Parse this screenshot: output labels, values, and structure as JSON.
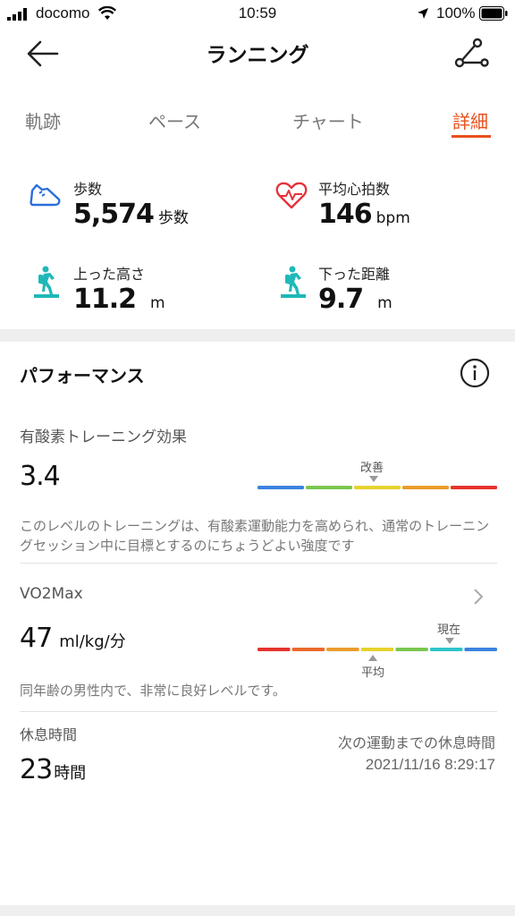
{
  "status_bar": {
    "carrier": "docomo",
    "time": "10:59",
    "battery": "100%"
  },
  "header": {
    "title": "ランニング"
  },
  "tabs": [
    {
      "label": "軌跡"
    },
    {
      "label": "ペース"
    },
    {
      "label": "チャート"
    },
    {
      "label": "詳細"
    }
  ],
  "metrics": {
    "steps": {
      "label": "歩数",
      "value": "5,574",
      "unit": "歩数"
    },
    "heart_rate": {
      "label": "平均心拍数",
      "value": "146",
      "unit": "bpm"
    },
    "ascent": {
      "label": "上った高さ",
      "value": "11.2",
      "unit": "m"
    },
    "descent": {
      "label": "下った距離",
      "value": "9.7",
      "unit": "m"
    }
  },
  "performance": {
    "title": "パフォーマンス",
    "aerobic": {
      "label": "有酸素トレーニング効果",
      "value": "3.4",
      "marker_label": "改善",
      "description": "このレベルのトレーニングは、有酸素運動能力を高められ、通常のトレーニングセッション中に目標とするのにちょうどよい強度です",
      "segment_colors": [
        "#3b82e0",
        "#7ac74f",
        "#e6d22e",
        "#eb9b2a",
        "#e6322e"
      ],
      "marker_segment": 2
    },
    "vo2max": {
      "label": "VO2Max",
      "value": "47",
      "unit": "ml/kg/分",
      "current_label": "現在",
      "average_label": "平均",
      "description": "同年齢の男性内で、非常に良好レベルです。",
      "segment_colors": [
        "#e6322e",
        "#eb6a2a",
        "#eb9b2a",
        "#e6d22e",
        "#7ac74f",
        "#2ec4c9",
        "#3b82e0"
      ],
      "current_segment": 5,
      "average_segment": 3
    },
    "rest": {
      "label": "休息時間",
      "value": "23",
      "unit": "時間",
      "next_label": "次の運動までの休息時間",
      "next_time": "2021/11/16 8:29:17"
    }
  }
}
